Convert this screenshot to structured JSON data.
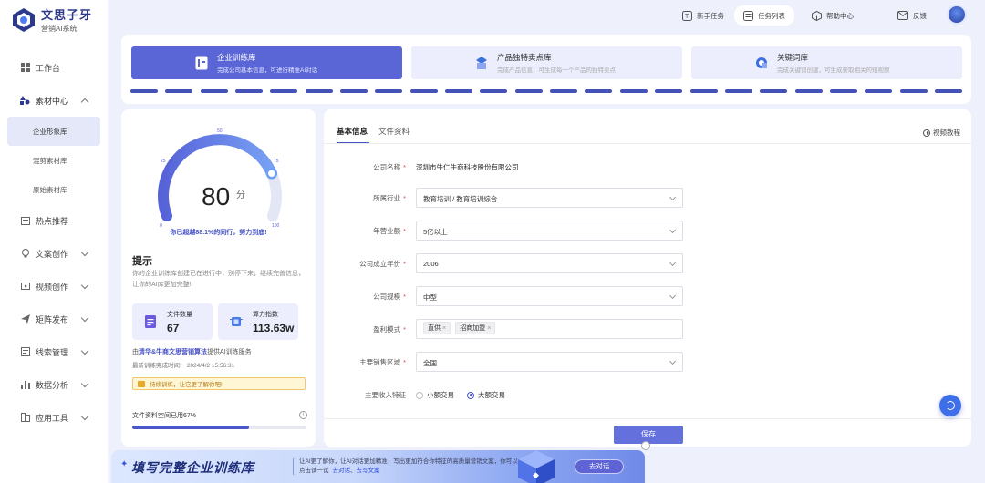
{
  "brand": {
    "name": "文思子牙",
    "subtitle": "营销AI系统"
  },
  "sidebar": {
    "items": [
      {
        "label": "工作台"
      },
      {
        "label": "素材中心"
      },
      {
        "label": "热点推荐"
      },
      {
        "label": "文案创作"
      },
      {
        "label": "视频创作"
      },
      {
        "label": "矩阵发布"
      },
      {
        "label": "线索管理"
      },
      {
        "label": "数据分析"
      },
      {
        "label": "应用工具"
      }
    ],
    "sub_items": [
      {
        "label": "企业形象库"
      },
      {
        "label": "混剪素材库"
      },
      {
        "label": "原始素材库"
      }
    ]
  },
  "topbar": {
    "newbie": "新手任务",
    "tasks": "任务列表",
    "help": "帮助中心",
    "feedback": "反馈"
  },
  "steps": [
    {
      "title": "企业训练库",
      "desc": "完成公司基本信息，可进行精准AI对话"
    },
    {
      "title": "产品独特卖点库",
      "desc": "完成产品信息，可生成每一个产品的独特卖点"
    },
    {
      "title": "关键词库",
      "desc": "完成关键词创建，可生成获取相关的短视频"
    }
  ],
  "score": {
    "value": "80",
    "unit": "分",
    "ticks": [
      "0",
      "25",
      "50",
      "75",
      "100"
    ],
    "percent": 80,
    "note": "你已超越88.1%的同行，努力到底!"
  },
  "tips": {
    "title": "提示",
    "text": "你的企业训练库创建已在进行中，别停下来，继续完善信息，让你的AI库更加完整!"
  },
  "stats": [
    {
      "label": "文件数量",
      "value": "67"
    },
    {
      "label": "算力指数",
      "value": "113.63w"
    }
  ],
  "credit": {
    "prefix": "由",
    "partner": "清华&牛商文思营销算法",
    "suffix": "提供AI训练服务"
  },
  "last_train": {
    "label": "最新训练完成时间:",
    "value": "2024/4/2 15:56:31"
  },
  "notice": "持续训练，让它更了解你吧!",
  "storage": {
    "label": "文件资料空间已用67%",
    "percent": 67,
    "info": "i"
  },
  "form": {
    "tabs": [
      "基本信息",
      "文件资料"
    ],
    "video_link": "视频教程",
    "company_name": {
      "label": "公司名称",
      "value": "深圳市牛仁牛商科技股份有限公司"
    },
    "industry": {
      "label": "所属行业",
      "value": "教育培训 / 教育培训综合"
    },
    "revenue": {
      "label": "年营业额",
      "value": "5亿以上"
    },
    "founded": {
      "label": "公司成立年份",
      "value": "2006"
    },
    "scale": {
      "label": "公司规模",
      "value": "中型"
    },
    "profit_model": {
      "label": "盈利模式",
      "tags": [
        "直供",
        "招商加盟"
      ],
      "remove": "×"
    },
    "region": {
      "label": "主要销售区域",
      "value": "全国"
    },
    "income": {
      "label": "主要收入特征",
      "options": [
        "小额交易",
        "大额交易"
      ],
      "selected": "大额交易"
    },
    "required_mark": "*",
    "save": "保存"
  },
  "banner": {
    "title": "填写完整企业训练库",
    "desc": "让AI更了解你，让AI对话更加精准，写出更加符合你特征的高质量营销文案，你可以点击试一试",
    "link1": "去对话",
    "link2": "去写文案",
    "sep": "、",
    "button": "去对话"
  },
  "colors": {
    "accent": "#4753c7",
    "accent_light": "#5a66d6",
    "bg": "#eef0fb",
    "required": "#e04848"
  }
}
